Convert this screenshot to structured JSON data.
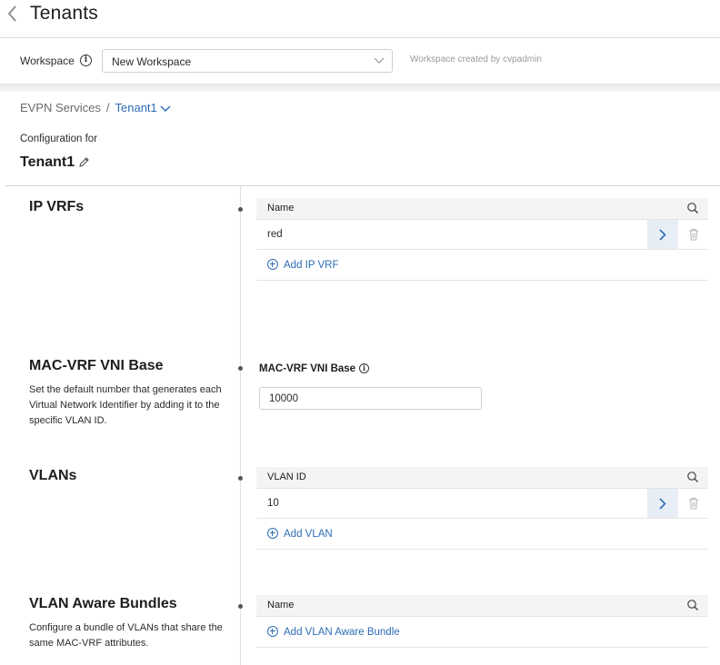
{
  "header": {
    "title": "Tenants"
  },
  "workspace": {
    "label": "Workspace",
    "selected": "New Workspace",
    "meta": "Workspace created by cvpadmin"
  },
  "breadcrumb": {
    "parent": "EVPN Services",
    "separator": "/",
    "current": "Tenant1"
  },
  "config": {
    "label": "Configuration for",
    "tenant": "Tenant1"
  },
  "sections": {
    "ip_vrfs": {
      "title": "IP VRFs",
      "column": "Name",
      "rows": [
        "red"
      ],
      "add_label": "Add IP VRF"
    },
    "mac_vrf": {
      "title": "MAC-VRF VNI Base",
      "description": "Set the default number that generates each Virtual Network Identifier by adding it to the specific VLAN ID.",
      "field_label": "MAC-VRF VNI Base",
      "value": "10000"
    },
    "vlans": {
      "title": "VLANs",
      "column": "VLAN ID",
      "rows": [
        "10"
      ],
      "add_label": "Add VLAN"
    },
    "bundles": {
      "title": "VLAN Aware Bundles",
      "description": "Configure a bundle of VLANs that share the same MAC-VRF attributes.",
      "column": "Name",
      "add_label": "Add VLAN Aware Bundle"
    }
  },
  "colors": {
    "accent": "#2d6db5",
    "row_action_bg": "#e8eef6"
  }
}
